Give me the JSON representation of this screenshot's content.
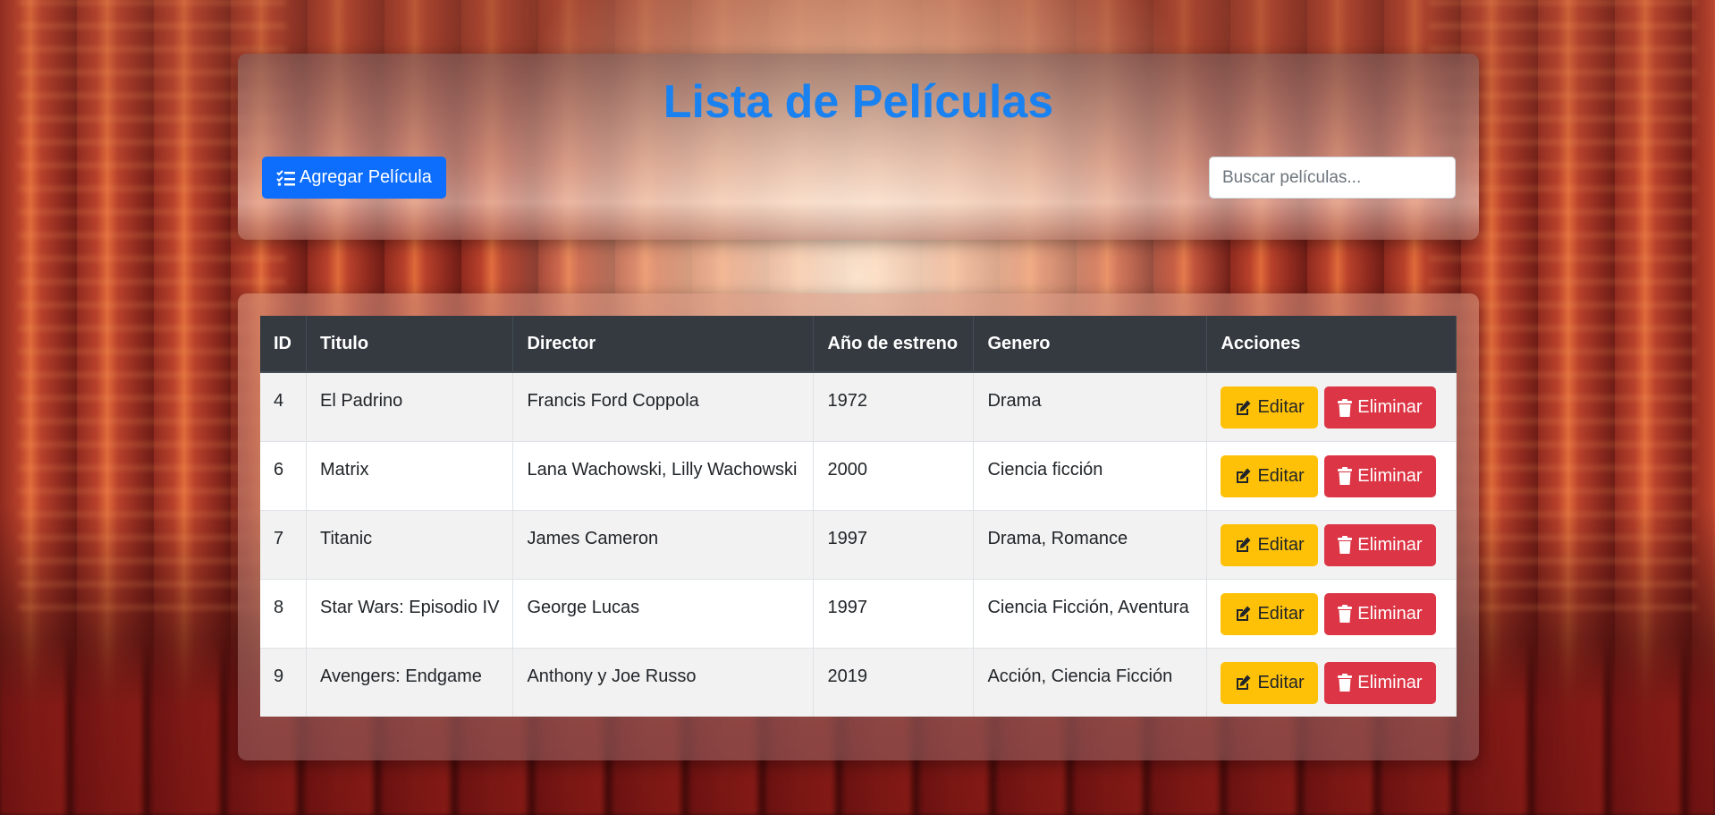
{
  "header": {
    "title": "Lista de Películas",
    "add_button_label": "Agregar Película",
    "search_placeholder": "Buscar películas..."
  },
  "table": {
    "columns": [
      "ID",
      "Titulo",
      "Director",
      "Año de estreno",
      "Genero",
      "Acciones"
    ],
    "rows": [
      {
        "id": "4",
        "titulo": "El Padrino",
        "director": "Francis Ford Coppola",
        "anio": "1972",
        "genero": "Drama"
      },
      {
        "id": "6",
        "titulo": "Matrix",
        "director": "Lana Wachowski, Lilly Wachowski",
        "anio": "2000",
        "genero": "Ciencia ficción"
      },
      {
        "id": "7",
        "titulo": "Titanic",
        "director": "James Cameron",
        "anio": "1997",
        "genero": "Drama, Romance"
      },
      {
        "id": "8",
        "titulo": "Star Wars: Episodio IV",
        "director": "George Lucas",
        "anio": "1997",
        "genero": "Ciencia Ficción, Aventura"
      },
      {
        "id": "9",
        "titulo": "Avengers: Endgame",
        "director": "Anthony y Joe Russo",
        "anio": "2019",
        "genero": "Acción, Ciencia Ficción"
      }
    ],
    "edit_label": "Editar",
    "delete_label": "Eliminar"
  },
  "colors": {
    "title": "#1a82f0",
    "primary": "#0d6efd",
    "warning": "#ffc107",
    "danger": "#dc3545",
    "table_header": "#343a40"
  },
  "icons": {
    "add": "list-check-icon",
    "edit": "edit-icon",
    "delete": "trash-icon"
  }
}
